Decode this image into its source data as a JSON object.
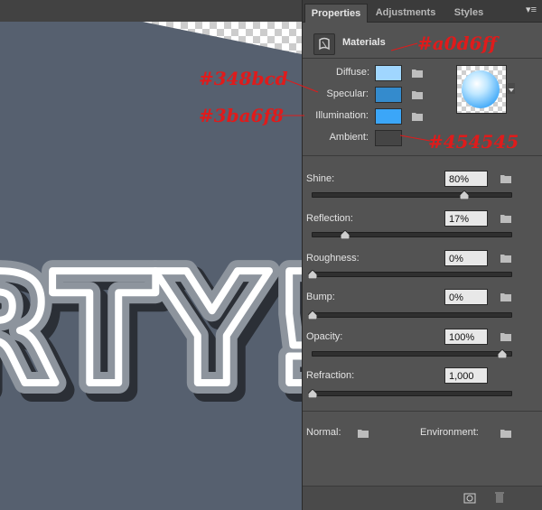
{
  "tabs": [
    {
      "label": "Properties"
    },
    {
      "label": "Adjustments"
    },
    {
      "label": "Styles"
    }
  ],
  "material": {
    "title": "Materials"
  },
  "channels": [
    {
      "label": "Diffuse:",
      "color": "#a0d6ff"
    },
    {
      "label": "Specular:",
      "color": "#348bcd"
    },
    {
      "label": "Illumination:",
      "color": "#3ba6f8"
    },
    {
      "label": "Ambient:",
      "color": "#454545"
    }
  ],
  "properties": [
    {
      "label": "Shine:",
      "value": "80%",
      "level": 0.8
    },
    {
      "label": "Reflection:",
      "value": "17%",
      "level": 0.17
    },
    {
      "label": "Roughness:",
      "value": "0%",
      "level": 0
    },
    {
      "label": "Bump:",
      "value": "0%",
      "level": 0
    },
    {
      "label": "Opacity:",
      "value": "100%",
      "level": 1
    },
    {
      "label": "Refraction:",
      "value": "1,000",
      "level": 0
    }
  ],
  "maps": {
    "normal": "Normal:",
    "environment": "Environment:"
  },
  "annotations": {
    "diffuse": "#a0d6ff",
    "specular": "#348bcd",
    "illumination": "#3ba6f8",
    "ambient": "#454545"
  },
  "canvas": {
    "text": "RTY!"
  }
}
